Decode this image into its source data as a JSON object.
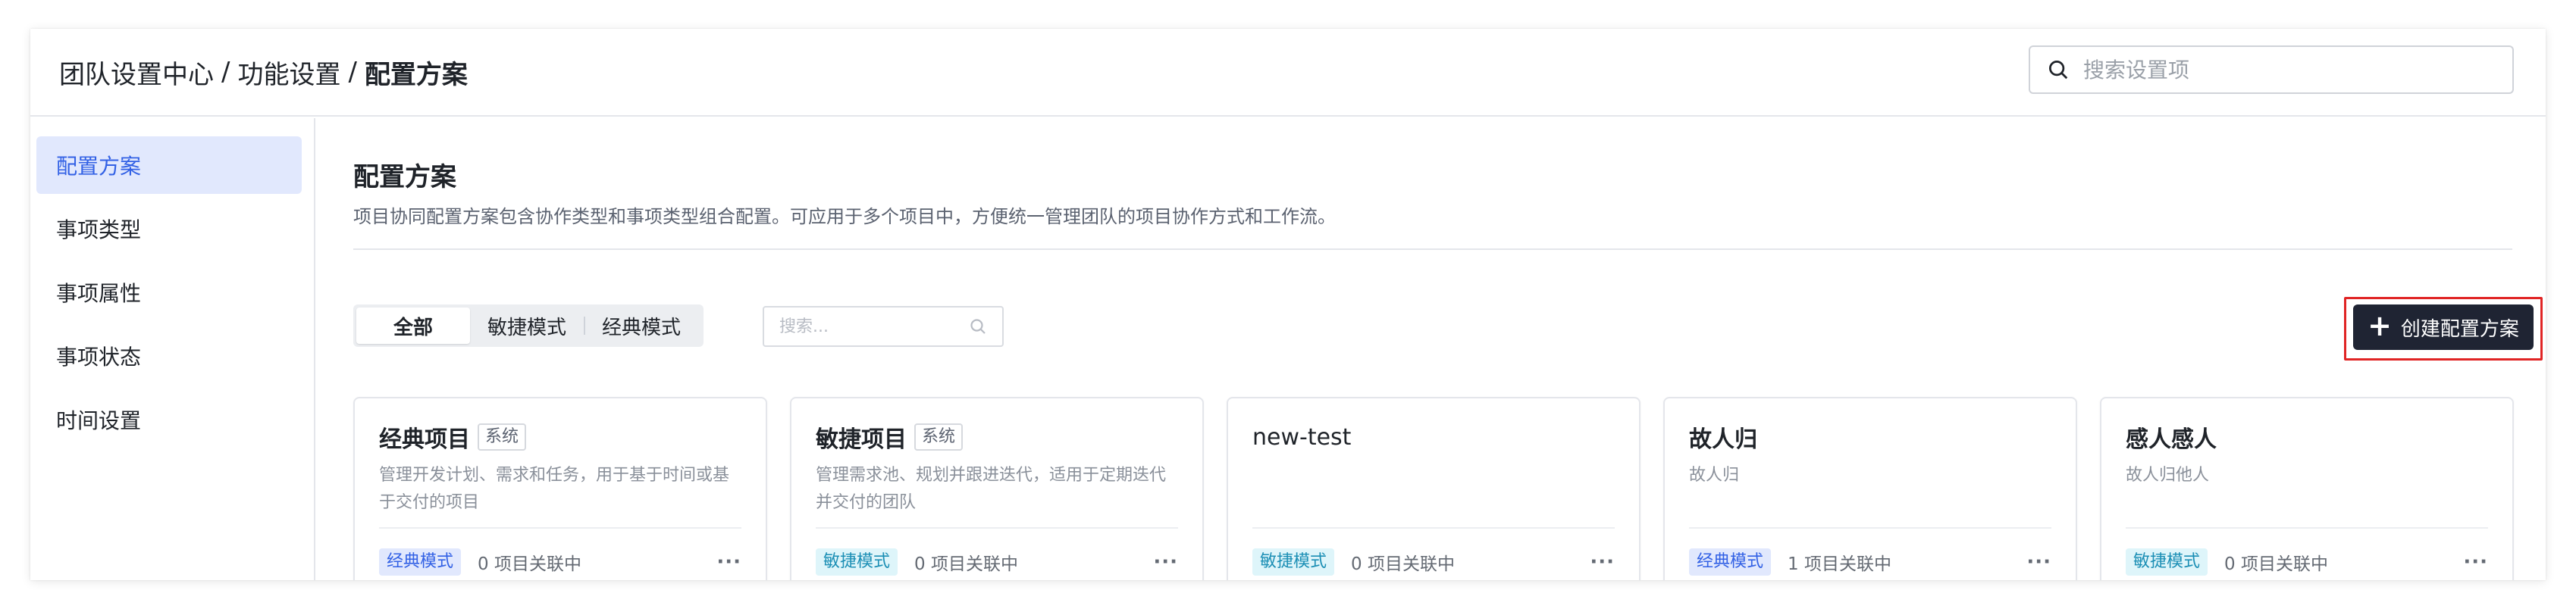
{
  "header": {
    "breadcrumb": [
      "团队设置中心",
      "功能设置",
      "配置方案"
    ],
    "separator": "/",
    "search_placeholder": "搜索设置项"
  },
  "sidebar": {
    "items": [
      {
        "label": "配置方案",
        "active": true
      },
      {
        "label": "事项类型",
        "active": false
      },
      {
        "label": "事项属性",
        "active": false
      },
      {
        "label": "事项状态",
        "active": false
      },
      {
        "label": "时间设置",
        "active": false
      }
    ]
  },
  "main": {
    "title": "配置方案",
    "description": "项目协同配置方案包含协作类型和事项类型组合配置。可应用于多个项目中，方便统一管理团队的项目协作方式和工作流。",
    "filters": {
      "tabs": [
        "全部",
        "敏捷模式",
        "经典模式"
      ],
      "selected": "全部",
      "search_placeholder": "搜索..."
    },
    "create_button": {
      "icon": "plus-icon",
      "label": "创建配置方案"
    },
    "cards": [
      {
        "name": "经典项目",
        "tag": "系统",
        "description": "管理开发计划、需求和任务，用于基于时间或基于交付的项目",
        "mode": "经典模式",
        "mode_type": "classic",
        "associated": "0 项目关联中",
        "more": "···"
      },
      {
        "name": "敏捷项目",
        "tag": "系统",
        "description": "管理需求池、规划并跟进迭代，适用于定期迭代并交付的团队",
        "mode": "敏捷模式",
        "mode_type": "agile",
        "associated": "0 项目关联中",
        "more": "···"
      },
      {
        "name": "new-test",
        "tag": "",
        "description": "",
        "mode": "敏捷模式",
        "mode_type": "agile",
        "associated": "0 项目关联中",
        "more": "···"
      },
      {
        "name": "故人归",
        "tag": "",
        "description": "故人归",
        "mode": "经典模式",
        "mode_type": "classic",
        "associated": "1 项目关联中",
        "more": "···"
      },
      {
        "name": "感人感人",
        "tag": "",
        "description": "故人归他人",
        "mode": "敏捷模式",
        "mode_type": "agile",
        "associated": "0 项目关联中",
        "more": "···"
      }
    ]
  },
  "colors": {
    "accent": "#3261e5",
    "active_bg": "#e1e8fd",
    "agile_badge": "#1c8fb5",
    "primary_button_bg": "#1f2433",
    "highlight_outline": "#e02424"
  }
}
